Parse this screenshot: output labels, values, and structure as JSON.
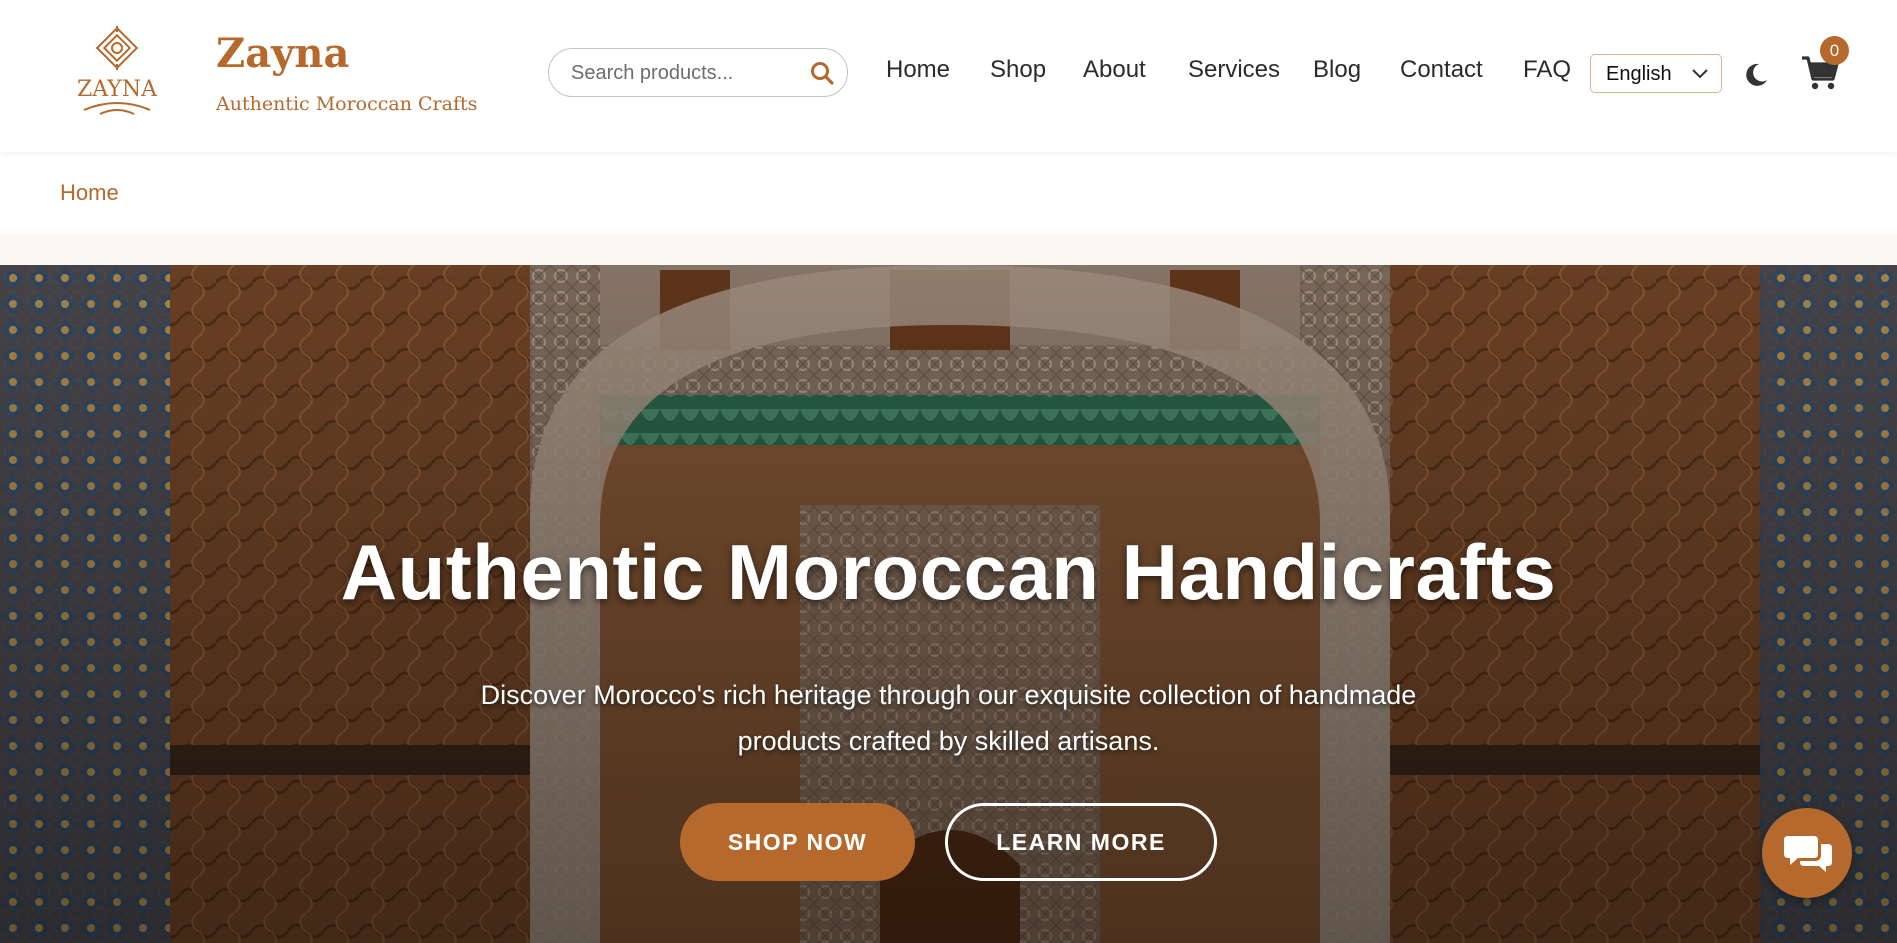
{
  "brand": {
    "logo_text": "ZAYNA",
    "name": "Zayna",
    "tagline": "Authentic Moroccan Crafts"
  },
  "search": {
    "placeholder": "Search products...",
    "icon": "search-icon"
  },
  "nav": {
    "items": [
      {
        "label": "Home"
      },
      {
        "label": "Shop"
      },
      {
        "label": "About"
      },
      {
        "label": "Services"
      },
      {
        "label": "Blog"
      },
      {
        "label": "Contact"
      },
      {
        "label": "FAQ"
      }
    ]
  },
  "language": {
    "selected": "English",
    "icon": "chevron-down-icon"
  },
  "theme_toggle": {
    "icon": "moon-icon"
  },
  "cart": {
    "icon": "cart-icon",
    "count": "0"
  },
  "breadcrumb": {
    "current": "Home"
  },
  "hero": {
    "title": "Authentic Moroccan Handicrafts",
    "subtitle": "Discover Morocco's rich heritage through our exquisite collection of handmade products crafted by skilled artisans.",
    "primary_button": "SHOP NOW",
    "secondary_button": "LEARN MORE"
  },
  "chat": {
    "icon": "chat-icon"
  },
  "colors": {
    "accent": "#b5692c",
    "text": "#2b2b2b",
    "background": "#ffffff",
    "strip": "#fbf7f2"
  }
}
